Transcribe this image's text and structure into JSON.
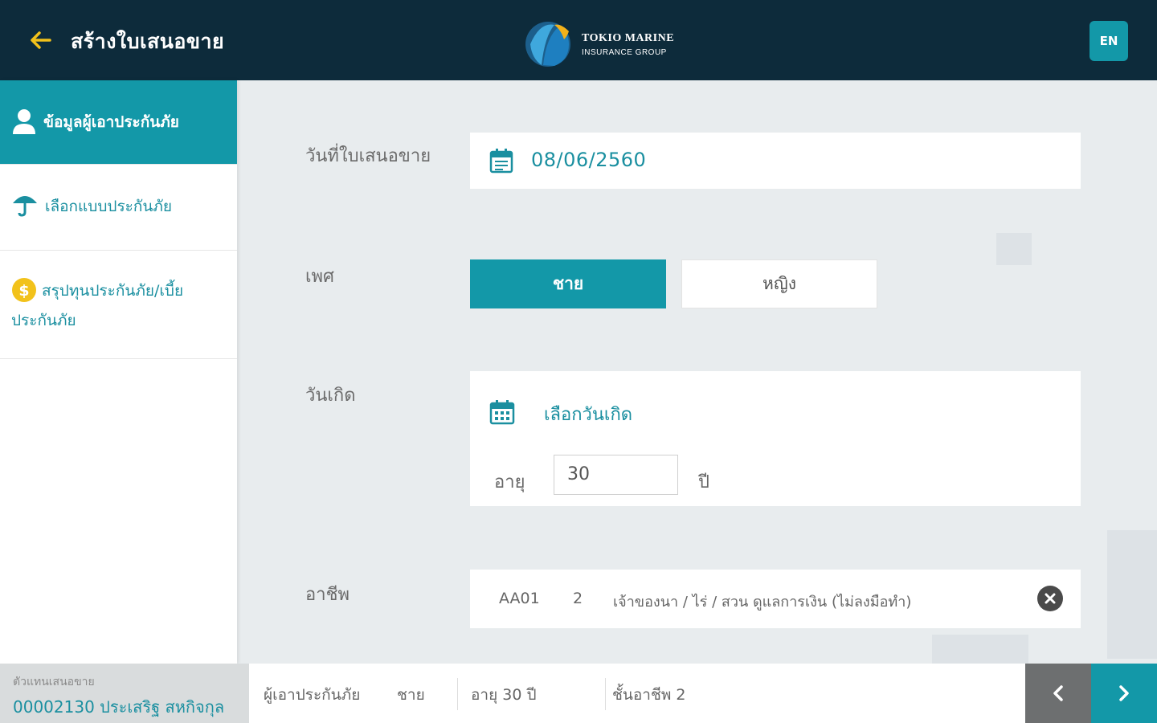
{
  "header": {
    "title": "สร้างใบเสนอขาย",
    "logo_line1": "TOKIO MARINE",
    "logo_line2": "INSURANCE GROUP",
    "lang_label": "EN"
  },
  "sidebar": {
    "items": [
      {
        "label": "ข้อมูลผู้เอาประกันภัย",
        "icon": "person-icon",
        "active": true
      },
      {
        "label": "เลือกแบบประกันภัย",
        "icon": "umbrella-icon",
        "active": false
      },
      {
        "label_line1": "สรุปทุนประกันภัย/เบี้ย",
        "label_line2": "ประกันภัย",
        "icon": "dollar-icon",
        "active": false
      }
    ]
  },
  "form": {
    "date_label": "วันที่ใบเสนอขาย",
    "date_value": "08/06/2560",
    "gender_label": "เพศ",
    "gender_male": "ชาย",
    "gender_female": "หญิง",
    "gender_selected": "ชาย",
    "birth_label": "วันเกิด",
    "birth_link": "เลือกวันเกิด",
    "age_label": "อายุ",
    "age_value": "30",
    "age_unit": "ปี",
    "occupation_label": "อาชีพ",
    "occupation_code": "AA01",
    "occupation_level": "2",
    "occupation_desc": "เจ้าของนา / ไร่ / สวน ดูแลการเงิน (ไม่ลงมือทำ)"
  },
  "footer": {
    "agent_label": "ตัวแทนเสนอขาย",
    "agent_name": "00002130 ประเสริฐ สหกิจกุล",
    "summary_insured": "ผู้เอาประกันภัย",
    "summary_gender": "ชาย",
    "summary_age": "อายุ 30 ปี",
    "summary_class": "ชั้นอาชีพ 2"
  },
  "colors": {
    "header_bg": "#0d2b3b",
    "accent": "#1398a8",
    "back_arrow": "#f2c21b",
    "dollar_icon": "#f2c21b"
  }
}
